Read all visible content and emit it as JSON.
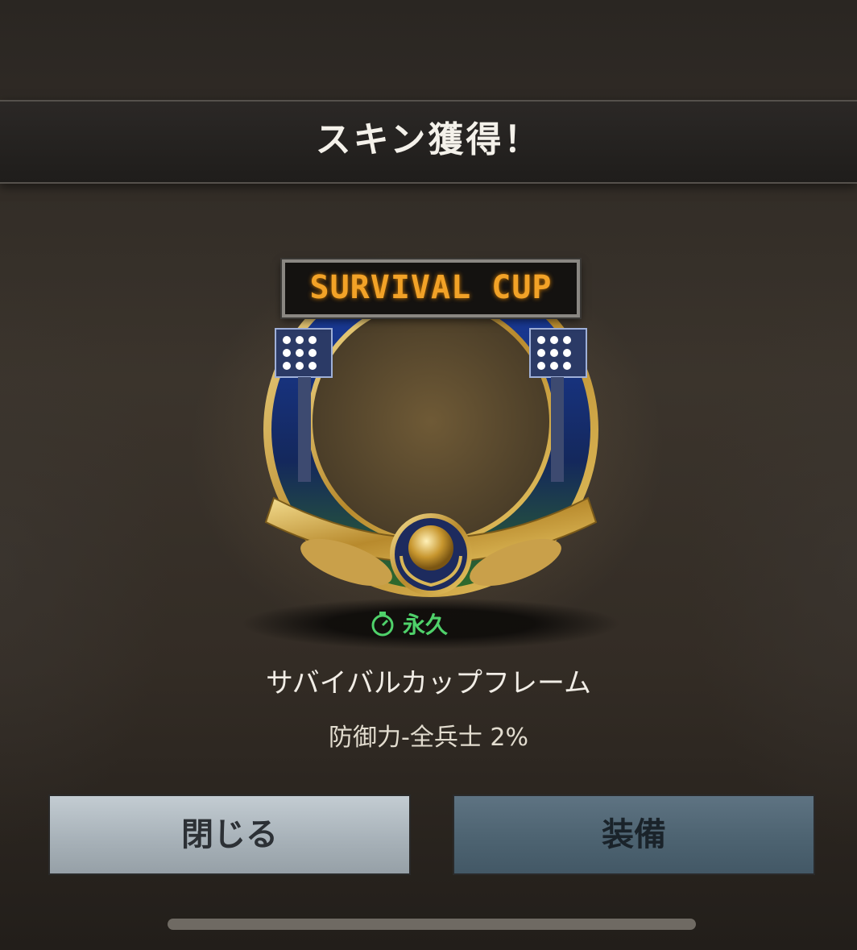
{
  "dialog": {
    "title": "スキン獲得！"
  },
  "skin": {
    "marquee_text": "SURVIVAL CUP",
    "duration_icon": "timer-icon",
    "duration": "永久",
    "name": "サバイバルカップフレーム",
    "effect": "防御力-全兵士 2%"
  },
  "buttons": {
    "close_label": "閉じる",
    "equip_label": "装備"
  },
  "colors": {
    "duration_green": "#4fd16a",
    "marquee_orange": "#f2a227",
    "close_button": "#a8b2b9",
    "equip_button": "#4d6371"
  }
}
